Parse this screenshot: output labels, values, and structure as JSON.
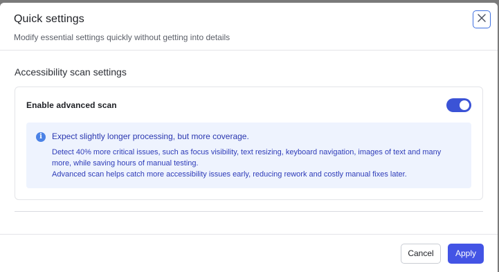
{
  "modal": {
    "title": "Quick settings",
    "subtitle": "Modify essential settings quickly without getting into details",
    "close_icon": "close-icon"
  },
  "section": {
    "title": "Accessibility scan settings"
  },
  "advanced_scan": {
    "label": "Enable advanced scan",
    "enabled": true
  },
  "info": {
    "icon": "info-icon",
    "icon_glyph": "i",
    "title": "Expect slightly longer processing, but more coverage.",
    "line1": "Detect 40% more critical issues, such as focus visibility, text resizing, keyboard navigation, images of text and many more, while saving hours of manual testing.",
    "line2": "Advanced scan helps catch more accessibility issues early, reducing rework and costly manual fixes later."
  },
  "footer": {
    "cancel_label": "Cancel",
    "apply_label": "Apply"
  },
  "colors": {
    "accent": "#4354e5",
    "toggle_on": "#3b53d6",
    "info_bg": "#eef3fe",
    "info_text": "#2d3bb8",
    "info_icon": "#4b82e6",
    "backdrop": "#7a7a7a"
  }
}
